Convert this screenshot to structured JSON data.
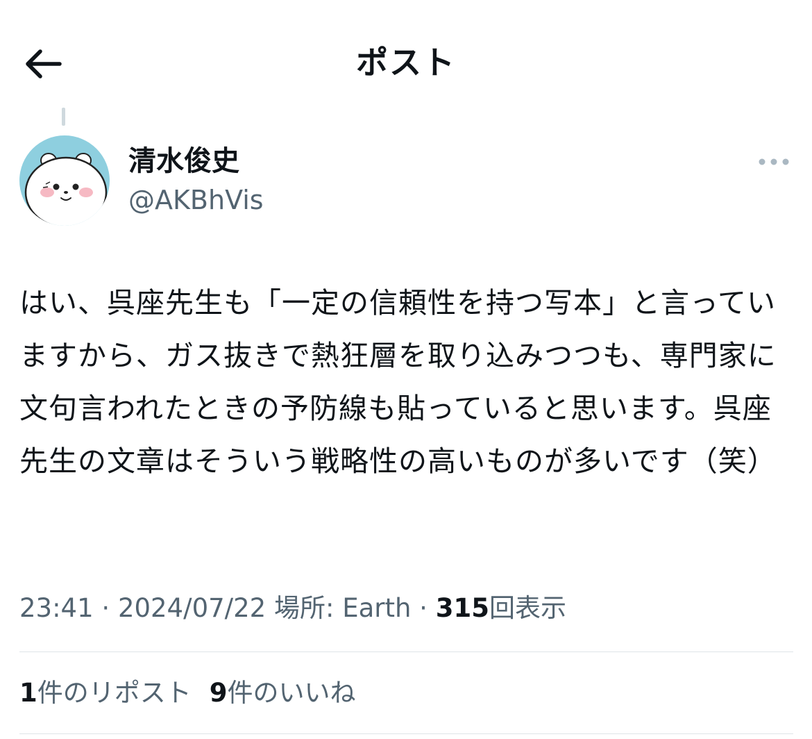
{
  "header": {
    "back_icon": "arrow-left-icon",
    "title": "ポスト"
  },
  "author": {
    "display_name": "清水俊史",
    "handle": "@AKBhVis",
    "avatar_icon": "bear-avatar"
  },
  "more_icon": "ellipsis-icon",
  "tweet": {
    "text": "はい、呉座先生も「一定の信頼性を持つ写本」と言っていますから、ガス抜きで熱狂層を取り込みつつも、専門家に文句言われたときの予防線も貼っていると思います。呉座先生の文章はそういう戦略性の高いものが多いです（笑）"
  },
  "meta": {
    "time": "23:41",
    "sep1": " · ",
    "date": "2024/07/22",
    "location_label": "場所: Earth",
    "sep2": " · ",
    "views_count": "315",
    "views_label": "回表示"
  },
  "stats": {
    "reposts_count": "1",
    "reposts_label": "件のリポスト",
    "likes_count": "9",
    "likes_label": "件のいいね"
  },
  "colors": {
    "text": "#0f1419",
    "secondary": "#536471",
    "divider": "#dfe4e8",
    "avatar_bg": "#8ecfdf"
  }
}
